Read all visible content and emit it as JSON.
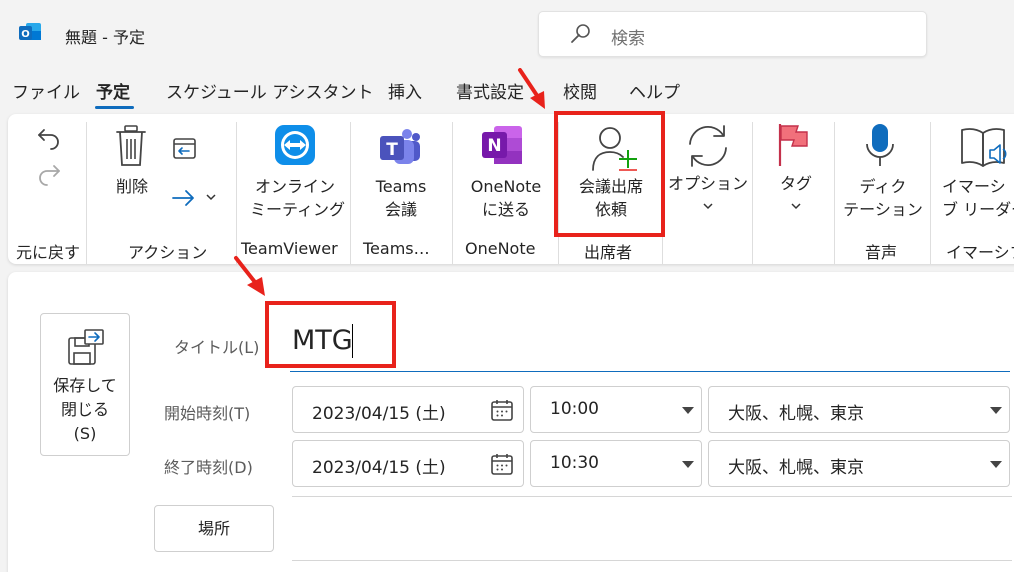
{
  "window": {
    "title": "無題 - 予定",
    "search_placeholder": "検索"
  },
  "tabs": [
    {
      "label": "ファイル"
    },
    {
      "label": "予定",
      "active": true
    },
    {
      "label": "スケジュール アシスタント"
    },
    {
      "label": "挿入"
    },
    {
      "label": "書式設定"
    },
    {
      "label": "校閲"
    },
    {
      "label": "ヘルプ"
    }
  ],
  "ribbon": {
    "undo_group_label": "元に戻す",
    "delete_label": "削除",
    "actions_group_label": "アクション",
    "online_meeting_line1": "オンライン",
    "online_meeting_line2": "ミーティング",
    "teamviewer_group_label": "TeamViewer",
    "teams_line1": "Teams",
    "teams_line2": "会議",
    "teams_group_label": "Teams…",
    "onenote_line1": "OneNote",
    "onenote_line2": "に送る",
    "onenote_group_label": "OneNote",
    "invite_line1": "会議出席",
    "invite_line2": "依頼",
    "attendees_group_label": "出席者",
    "options_label": "オプション",
    "tags_label": "タグ",
    "dictate_line1": "ディク",
    "dictate_line2": "テーション",
    "voice_group_label": "音声",
    "immersive_line1": "イマーシ",
    "immersive_line2": "ブ リーダー",
    "immersive_group_label": "イマーシブ"
  },
  "form": {
    "save_close_line1": "保存して",
    "save_close_line2": "閉じる",
    "save_close_line3": "(S)",
    "title_label": "タイトル(L)",
    "title_value": "MTG",
    "start_label": "開始時刻(T)",
    "start_date": "2023/04/15 (土)",
    "start_time": "10:00",
    "start_timezone": "大阪、札幌、東京",
    "end_label": "終了時刻(D)",
    "end_date": "2023/04/15 (土)",
    "end_time": "10:30",
    "end_timezone": "大阪、札幌、東京",
    "location_button": "場所"
  },
  "colors": {
    "accent": "#0f6cbd",
    "highlight": "#e8221b",
    "outlook_blue": "#0f6cbd",
    "teams_purple": "#5b5fc7",
    "onenote_purple": "#7719aa",
    "teamviewer_blue": "#0e8ee9",
    "add_green": "#13a10e"
  }
}
